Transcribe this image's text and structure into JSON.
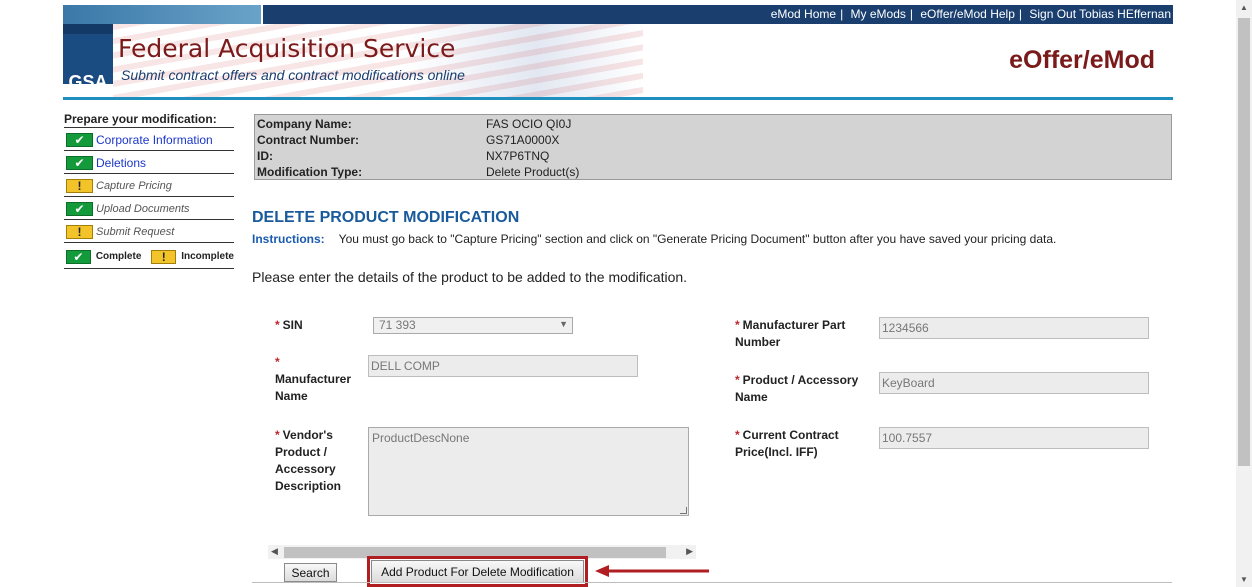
{
  "topnav": {
    "links": [
      "eMod Home",
      "My eMods",
      "eOffer/eMod Help",
      "Sign Out Tobias HEffernan"
    ]
  },
  "header": {
    "logo_text": "GSA",
    "title": "Federal Acquisition Service",
    "subtitle": "Submit contract offers and contract modifications online",
    "brand": "eOffer/eMod"
  },
  "sidebar": {
    "title": "Prepare your modification:",
    "items": [
      {
        "label": "Corporate Information",
        "status": "complete"
      },
      {
        "label": "Deletions",
        "status": "complete"
      },
      {
        "label": "Capture Pricing",
        "status": "incomplete"
      },
      {
        "label": "Upload Documents",
        "status": "complete"
      },
      {
        "label": "Submit Request",
        "status": "incomplete"
      }
    ],
    "legend": {
      "complete": "Complete",
      "incomplete": "Incomplete"
    },
    "colors": {
      "complete": "#139a3a",
      "incomplete": "#f2c42a"
    }
  },
  "info": {
    "company_label": "Company Name:",
    "company_value": "FAS OCIO QI0J",
    "contract_label": "Contract Number:",
    "contract_value": "GS71A0000X",
    "id_label": "ID:",
    "id_value": "NX7P6TNQ",
    "modtype_label": "Modification Type:",
    "modtype_value": "Delete Product(s)"
  },
  "main": {
    "title": "DELETE PRODUCT MODIFICATION",
    "instructions_label": "Instructions:",
    "instructions_text": "You must go back to \"Capture Pricing\" section and click on \"Generate Pricing Document\" button after you have saved your pricing data.",
    "lead": "Please enter the details of the product to be added to the modification."
  },
  "form": {
    "required_mark": "*",
    "sin_label": "SIN",
    "sin_value": "71 393",
    "manufacturer_label": "Manufacturer Name",
    "manufacturer_value": "DELL COMP",
    "description_label": "Vendor's Product / Accessory Description",
    "description_value": "ProductDescNone",
    "part_label": "Manufacturer Part Number",
    "part_value": "1234566",
    "product_label": "Product / Accessory Name",
    "product_value": "KeyBoard",
    "price_label": "Current Contract Price(Incl. IFF)",
    "price_value": "100.7557"
  },
  "buttons": {
    "search": "Search",
    "add": "Add Product For Delete Modification"
  },
  "colors": {
    "accent": "#1a5a9a",
    "brand": "#7a1a1a",
    "highlight": "#b01e22"
  }
}
